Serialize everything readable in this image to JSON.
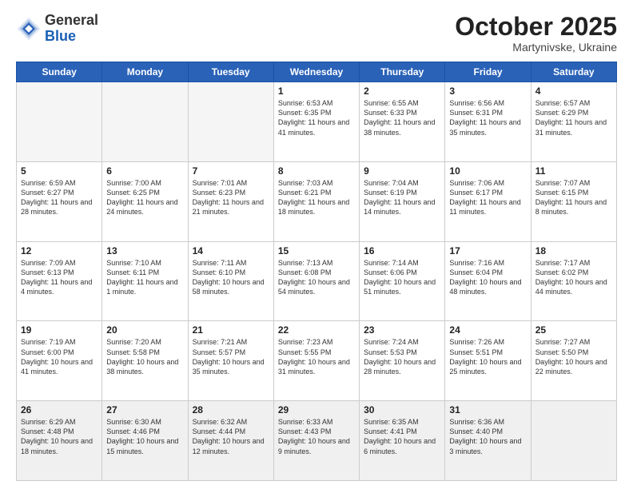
{
  "header": {
    "logo_general": "General",
    "logo_blue": "Blue",
    "month": "October 2025",
    "location": "Martynivske, Ukraine"
  },
  "days_of_week": [
    "Sunday",
    "Monday",
    "Tuesday",
    "Wednesday",
    "Thursday",
    "Friday",
    "Saturday"
  ],
  "weeks": [
    [
      {
        "num": "",
        "text": ""
      },
      {
        "num": "",
        "text": ""
      },
      {
        "num": "",
        "text": ""
      },
      {
        "num": "1",
        "text": "Sunrise: 6:53 AM\nSunset: 6:35 PM\nDaylight: 11 hours\nand 41 minutes."
      },
      {
        "num": "2",
        "text": "Sunrise: 6:55 AM\nSunset: 6:33 PM\nDaylight: 11 hours\nand 38 minutes."
      },
      {
        "num": "3",
        "text": "Sunrise: 6:56 AM\nSunset: 6:31 PM\nDaylight: 11 hours\nand 35 minutes."
      },
      {
        "num": "4",
        "text": "Sunrise: 6:57 AM\nSunset: 6:29 PM\nDaylight: 11 hours\nand 31 minutes."
      }
    ],
    [
      {
        "num": "5",
        "text": "Sunrise: 6:59 AM\nSunset: 6:27 PM\nDaylight: 11 hours\nand 28 minutes."
      },
      {
        "num": "6",
        "text": "Sunrise: 7:00 AM\nSunset: 6:25 PM\nDaylight: 11 hours\nand 24 minutes."
      },
      {
        "num": "7",
        "text": "Sunrise: 7:01 AM\nSunset: 6:23 PM\nDaylight: 11 hours\nand 21 minutes."
      },
      {
        "num": "8",
        "text": "Sunrise: 7:03 AM\nSunset: 6:21 PM\nDaylight: 11 hours\nand 18 minutes."
      },
      {
        "num": "9",
        "text": "Sunrise: 7:04 AM\nSunset: 6:19 PM\nDaylight: 11 hours\nand 14 minutes."
      },
      {
        "num": "10",
        "text": "Sunrise: 7:06 AM\nSunset: 6:17 PM\nDaylight: 11 hours\nand 11 minutes."
      },
      {
        "num": "11",
        "text": "Sunrise: 7:07 AM\nSunset: 6:15 PM\nDaylight: 11 hours\nand 8 minutes."
      }
    ],
    [
      {
        "num": "12",
        "text": "Sunrise: 7:09 AM\nSunset: 6:13 PM\nDaylight: 11 hours\nand 4 minutes."
      },
      {
        "num": "13",
        "text": "Sunrise: 7:10 AM\nSunset: 6:11 PM\nDaylight: 11 hours\nand 1 minute."
      },
      {
        "num": "14",
        "text": "Sunrise: 7:11 AM\nSunset: 6:10 PM\nDaylight: 10 hours\nand 58 minutes."
      },
      {
        "num": "15",
        "text": "Sunrise: 7:13 AM\nSunset: 6:08 PM\nDaylight: 10 hours\nand 54 minutes."
      },
      {
        "num": "16",
        "text": "Sunrise: 7:14 AM\nSunset: 6:06 PM\nDaylight: 10 hours\nand 51 minutes."
      },
      {
        "num": "17",
        "text": "Sunrise: 7:16 AM\nSunset: 6:04 PM\nDaylight: 10 hours\nand 48 minutes."
      },
      {
        "num": "18",
        "text": "Sunrise: 7:17 AM\nSunset: 6:02 PM\nDaylight: 10 hours\nand 44 minutes."
      }
    ],
    [
      {
        "num": "19",
        "text": "Sunrise: 7:19 AM\nSunset: 6:00 PM\nDaylight: 10 hours\nand 41 minutes."
      },
      {
        "num": "20",
        "text": "Sunrise: 7:20 AM\nSunset: 5:58 PM\nDaylight: 10 hours\nand 38 minutes."
      },
      {
        "num": "21",
        "text": "Sunrise: 7:21 AM\nSunset: 5:57 PM\nDaylight: 10 hours\nand 35 minutes."
      },
      {
        "num": "22",
        "text": "Sunrise: 7:23 AM\nSunset: 5:55 PM\nDaylight: 10 hours\nand 31 minutes."
      },
      {
        "num": "23",
        "text": "Sunrise: 7:24 AM\nSunset: 5:53 PM\nDaylight: 10 hours\nand 28 minutes."
      },
      {
        "num": "24",
        "text": "Sunrise: 7:26 AM\nSunset: 5:51 PM\nDaylight: 10 hours\nand 25 minutes."
      },
      {
        "num": "25",
        "text": "Sunrise: 7:27 AM\nSunset: 5:50 PM\nDaylight: 10 hours\nand 22 minutes."
      }
    ],
    [
      {
        "num": "26",
        "text": "Sunrise: 6:29 AM\nSunset: 4:48 PM\nDaylight: 10 hours\nand 18 minutes."
      },
      {
        "num": "27",
        "text": "Sunrise: 6:30 AM\nSunset: 4:46 PM\nDaylight: 10 hours\nand 15 minutes."
      },
      {
        "num": "28",
        "text": "Sunrise: 6:32 AM\nSunset: 4:44 PM\nDaylight: 10 hours\nand 12 minutes."
      },
      {
        "num": "29",
        "text": "Sunrise: 6:33 AM\nSunset: 4:43 PM\nDaylight: 10 hours\nand 9 minutes."
      },
      {
        "num": "30",
        "text": "Sunrise: 6:35 AM\nSunset: 4:41 PM\nDaylight: 10 hours\nand 6 minutes."
      },
      {
        "num": "31",
        "text": "Sunrise: 6:36 AM\nSunset: 4:40 PM\nDaylight: 10 hours\nand 3 minutes."
      },
      {
        "num": "",
        "text": ""
      }
    ]
  ]
}
